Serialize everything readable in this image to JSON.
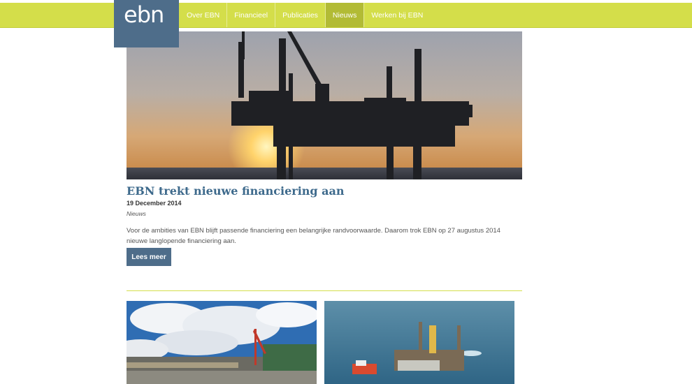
{
  "brand": {
    "logo_text": "ebn",
    "accent": "#d4de4a",
    "primary": "#4e6d8a"
  },
  "nav": {
    "items": [
      {
        "label": "Over EBN"
      },
      {
        "label": "Financieel"
      },
      {
        "label": "Publicaties"
      },
      {
        "label": "Nieuws",
        "active": true
      },
      {
        "label": "Werken bij EBN"
      }
    ]
  },
  "article": {
    "title": "EBN trekt nieuwe financiering aan",
    "date": "19 December 2014",
    "category": "Nieuws",
    "text": "Voor de ambities van EBN blijft passende financiering een belangrijke randvoorwaarde. Daarom trok EBN op 27 augustus 2014 nieuwe langlopende financiering aan.",
    "read_more": "Lees meer",
    "image_name": "offshore-platform-sunset"
  },
  "thumbnails": [
    {
      "image_name": "industrial-site-clouds"
    },
    {
      "image_name": "offshore-rig-aerial"
    }
  ]
}
